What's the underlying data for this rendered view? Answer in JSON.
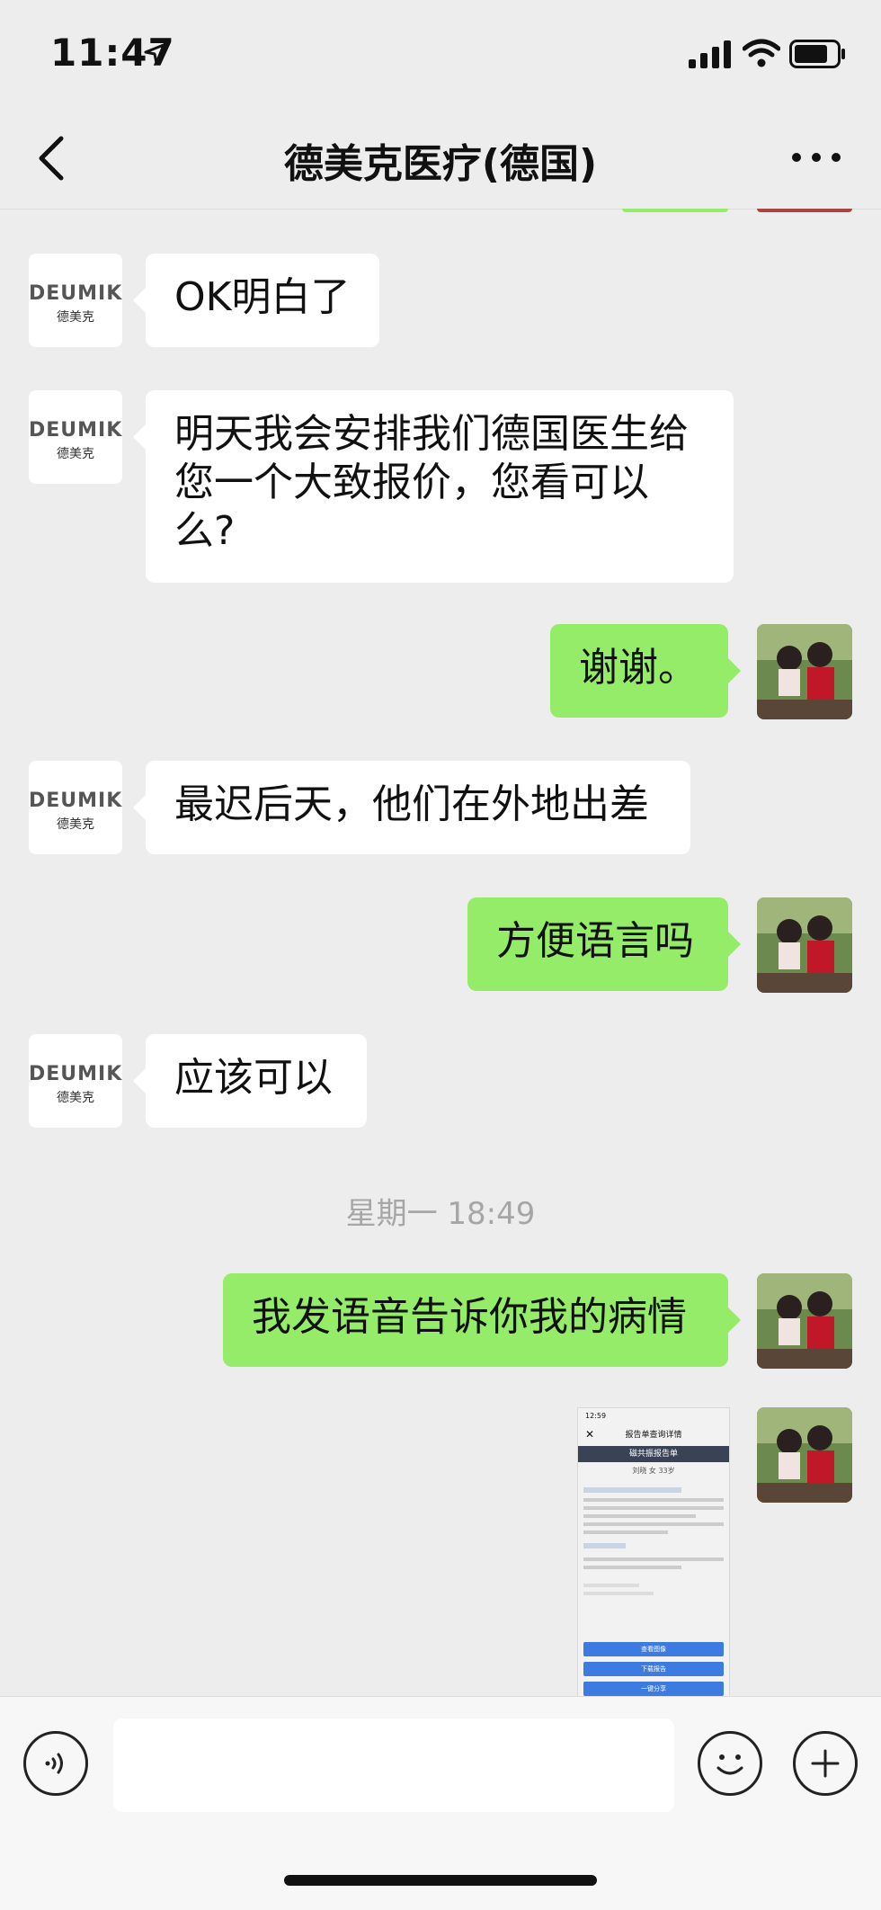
{
  "status": {
    "time": "11:47"
  },
  "header": {
    "title": "德美克医疗(德国)"
  },
  "avatars": {
    "brand": "DEUMIK",
    "brand_sub": "德美克"
  },
  "messages": [
    {
      "side": "left",
      "text": "OK明白了"
    },
    {
      "side": "left",
      "text": "明天我会安排我们德国医生给您一个大致报价，您看可以么?"
    },
    {
      "side": "right",
      "text": "谢谢。"
    },
    {
      "side": "left",
      "text": "最迟后天，他们在外地出差"
    },
    {
      "side": "right",
      "text": "方便语言吗"
    },
    {
      "side": "left",
      "text": "应该可以"
    },
    {
      "side": "right",
      "text": "我发语音告诉你我的病情"
    }
  ],
  "timestamp": "星期一 18:49",
  "image_msg": {
    "mini_time": "12:59",
    "mini_title": "报告单查询详情",
    "report_header": "磁共振报告单",
    "patient": "刘晓 女 33岁",
    "buttons": [
      "查看图像",
      "下载报告",
      "一键分享"
    ]
  },
  "colors": {
    "bubble_right": "#95ec69",
    "bubble_left": "#ffffff",
    "background": "#ededed"
  }
}
